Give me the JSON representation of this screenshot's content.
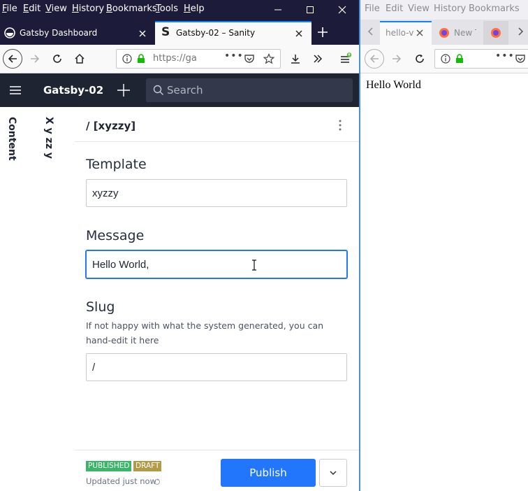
{
  "left_window": {
    "menu": [
      "File",
      "Edit",
      "View",
      "History",
      "Bookmarks",
      "Tools",
      "Help"
    ],
    "tabs": [
      {
        "label": "Gatsby Dashboard",
        "active": false
      },
      {
        "label": "Gatsby-02 – Sanity",
        "active": true
      }
    ],
    "url": "https://ga",
    "studio": {
      "project_name": "Gatsby-02",
      "search_placeholder": "Search",
      "panes": [
        "Content",
        "X y zz y"
      ],
      "document": {
        "title": "/ [xyzzy]",
        "fields": {
          "template": {
            "label": "Template",
            "value": "xyzzy"
          },
          "message": {
            "label": "Message",
            "value": "Hello World, "
          },
          "slug": {
            "label": "Slug",
            "description": "If not happy with what the system generated, you can hand-edit it here",
            "value": "/"
          }
        },
        "footer": {
          "badge_published": "PUBLISHED",
          "badge_draft": "DRAFT",
          "status": "Updated just now",
          "publish_label": "Publish"
        }
      }
    }
  },
  "right_window": {
    "menu": [
      "File",
      "Edit",
      "View",
      "History",
      "Bookmarks"
    ],
    "tabs": [
      {
        "label": "hello-v",
        "active": true
      },
      {
        "label": "New T",
        "active": false
      }
    ],
    "content_text": "Hello World"
  },
  "colors": {
    "titlebar": "#1c1b3a",
    "studio_header": "#1f2433",
    "accent_blue": "#2276fc",
    "badge_published": "#3ab667",
    "badge_draft": "#b39a47"
  }
}
